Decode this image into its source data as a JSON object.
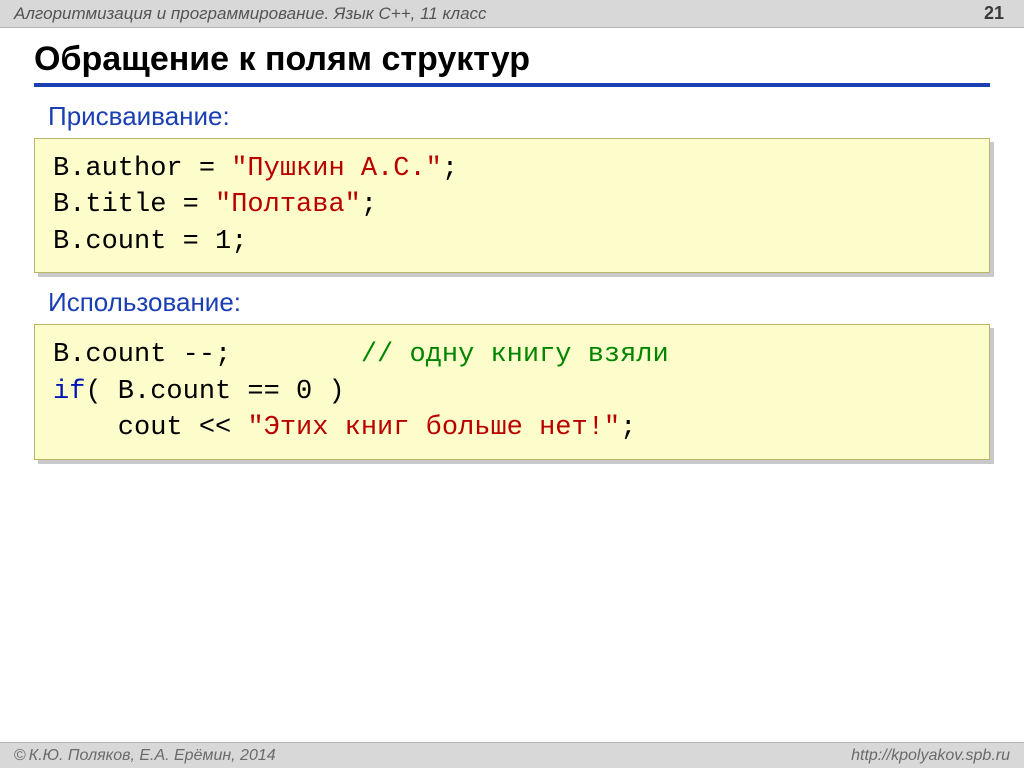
{
  "header": {
    "course": "Алгоритмизация и программирование. Язык C++, 11 класс",
    "page": "21"
  },
  "title": "Обращение к полям структур",
  "section1": {
    "label": "Присваивание:",
    "line1_pre": "B.author = ",
    "line1_str": "\"Пушкин А.С.\"",
    "line1_post": ";",
    "line2_pre": "B.title = ",
    "line2_str": "\"Полтава\"",
    "line2_post": ";",
    "line3_pre": "B.count = ",
    "line3_num": "1",
    "line3_post": ";"
  },
  "section2": {
    "label": "Использование:",
    "l1a": "B.count --;        ",
    "l1b": "// одну книгу взяли",
    "l2_if": "if",
    "l2_rest": "( B.count == 0 )",
    "l3_indent": "    cout << ",
    "l3_str": "\"Этих книг больше нет!\"",
    "l3_post": ";"
  },
  "footer": {
    "copy_sym": "©",
    "authors": " К.Ю. Поляков, Е.А. Ерёмин, 2014",
    "url": "http://kpolyakov.spb.ru"
  }
}
